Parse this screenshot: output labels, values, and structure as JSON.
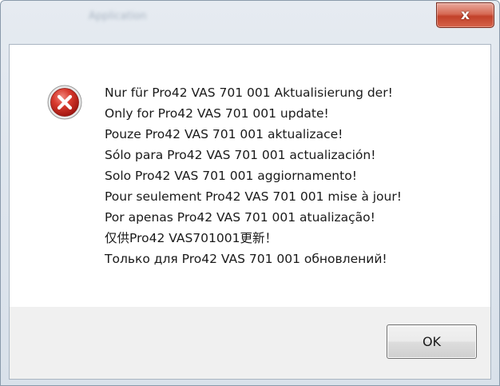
{
  "window": {
    "title": "Application",
    "close_label": "x"
  },
  "dialog": {
    "icon": "error-icon",
    "messages": [
      "Nur für Pro42 VAS 701 001 Aktualisierung der!",
      "Only for Pro42 VAS 701 001 update!",
      "Pouze Pro42 VAS 701 001 aktualizace!",
      "Sólo para Pro42 VAS 701 001 actualización!",
      "Solo Pro42 VAS 701 001 aggiornamento!",
      "Pour seulement Pro42 VAS 701 001 mise à jour!",
      "Por apenas Pro42 VAS 701 001 atualização!",
      "仅供Pro42 VAS701001更新！",
      "Только для Pro42 VAS 701 001 обновлений!"
    ],
    "ok_label": "OK"
  },
  "colors": {
    "close_button": "#c2412a",
    "error_icon": "#c62828",
    "button_bar": "#f0f0f0"
  }
}
